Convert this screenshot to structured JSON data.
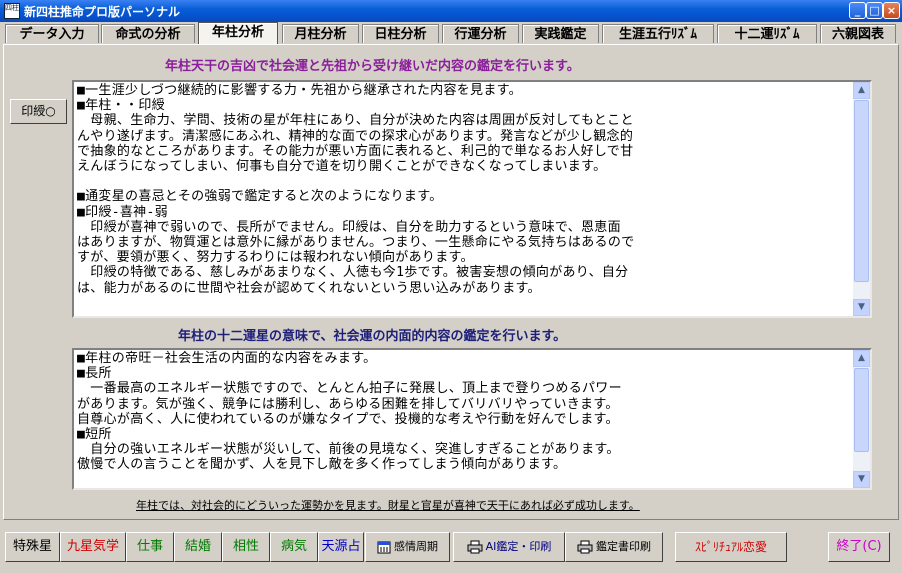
{
  "window": {
    "title": "新四柱推命プロ版パーソナル",
    "app_icon_text": "四柱",
    "controls": [
      "minimize",
      "maximize",
      "close"
    ]
  },
  "tabs": [
    {
      "label": "データ入力"
    },
    {
      "label": "命式の分析"
    },
    {
      "label": "年柱分析",
      "active": true
    },
    {
      "label": "月柱分析"
    },
    {
      "label": "日柱分析"
    },
    {
      "label": "行運分析"
    },
    {
      "label": "実践鑑定"
    },
    {
      "label": "生涯五行ﾘｽﾞﾑ"
    },
    {
      "label": "十二運ﾘｽﾞﾑ"
    },
    {
      "label": "六親図表"
    }
  ],
  "section1": {
    "heading": "年柱天干の吉凶で社会運と先祖から受け継いだ内容の鑑定を行います。",
    "print_button": "印綬○",
    "text": "■一生涯少しづつ継続的に影響する力・先祖から継承された内容を見ます。\n■年柱・・印綬\n　母親、生命力、学問、技術の星が年柱にあり、自分が決めた内容は周囲が反対してもとこと\nんやり遂げます。清潔感にあふれ、精神的な面での探求心があります。発言などが少し観念的\nで抽象的なところがあります。その能力が悪い方面に表れると、利己的で単なるお人好しで甘\nえんぼうになってしまい、何事も自分で道を切り開くことができなくなってしまいます。\n\n■通変星の喜忌とその強弱で鑑定すると次のようになります。\n■印綬-喜神-弱\n　印綬が喜神で弱いので、長所がでません。印綬は、自分を助力するという意味で、恩恵面\nはありますが、物質運とは意外に縁がありません。つまり、一生懸命にやる気持ちはあるので\nすが、要領が悪く、努力するわりには報われない傾向があります。\n　印綬の特徴である、慈しみがあまりなく、人徳も今1歩です。被害妄想の傾向があり、自分\nは、能力があるのに世間や社会が認めてくれないという思い込みがあります。"
  },
  "section2": {
    "heading": "年柱の十二運星の意味で、社会運の内面的内容の鑑定を行います。",
    "text": "■年柱の帝旺－社会生活の内面的な内容をみます。\n■長所\n　一番最高のエネルギー状態ですので、とんとん拍子に発展し、頂上まで登りつめるパワー\nがあります。気が強く、競争には勝利し、あらゆる困難を排してバリバリやっていきます。\n自尊心が高く、人に使われているのが嫌なタイプで、投機的な考えや行動を好んでします。\n■短所\n　自分の強いエネルギー状態が災いして、前後の見境なく、突進しすぎることがあります。\n傲慢で人の言うことを聞かず、人を見下し敵を多く作ってしまう傾向があります。"
  },
  "note": "年柱では、対社会的にどういった運勢かを見ます。財星と官星が喜神で天干にあれば必ず成功します。",
  "bottom_buttons": [
    {
      "label": "特殊星",
      "color": "#000000"
    },
    {
      "label": "九星気学",
      "color": "#d00000"
    },
    {
      "label": "仕事",
      "color": "#007a00"
    },
    {
      "label": "結婚",
      "color": "#007a00"
    },
    {
      "label": "相性",
      "color": "#007a00"
    },
    {
      "label": "病気",
      "color": "#007a00"
    },
    {
      "label": "天源占",
      "color": "#0000c8"
    },
    {
      "label": "感情周期",
      "color": "#000000",
      "icon": "calendar-icon"
    },
    {
      "label": "AI鑑定・印刷",
      "color": "#000080",
      "icon": "printer-icon"
    },
    {
      "label": "鑑定書印刷",
      "color": "#000000",
      "icon": "printer-icon"
    },
    {
      "label": "ｽﾋﾟﾘﾁｭｱﾙ恋愛",
      "color": "#d00000"
    },
    {
      "label": "終了(C)",
      "color": "#c800c8"
    }
  ]
}
